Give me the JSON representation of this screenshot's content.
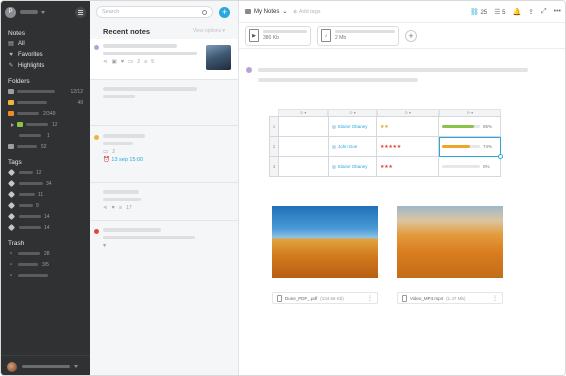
{
  "sidebar": {
    "avatar_letter": "P",
    "sections": {
      "notes": "Notes",
      "folders": "Folders",
      "tags": "Tags",
      "trash": "Trash"
    },
    "nav": [
      {
        "label": "All",
        "icon": "notes-icon"
      },
      {
        "label": "Favorites",
        "icon": "heart-icon"
      },
      {
        "label": "Highlights",
        "icon": "pen-icon"
      }
    ],
    "folders": [
      {
        "count": "12/12",
        "color": "#9b9ea1"
      },
      {
        "count": "49",
        "color": "#f0b437"
      },
      {
        "count": "2/349",
        "color": "#f08a24"
      },
      {
        "count": "12",
        "color": "#8bc34a"
      },
      {
        "count": "1",
        "color": "#9b9ea1"
      },
      {
        "count": "52",
        "color": "#9b9ea1"
      }
    ],
    "tags": [
      "12",
      "34",
      "11",
      "9",
      "14",
      "14"
    ],
    "trash": [
      "28",
      "3/5",
      ""
    ]
  },
  "notes_list": {
    "search_placeholder": "Search",
    "header": "Recent notes",
    "view_options": "View options",
    "notes": [
      {
        "dot": "#b9a3d6",
        "likes": "2",
        "comments": "5",
        "has_thumb": true
      },
      {
        "dot": "",
        "has_thumb": false
      },
      {
        "dot": "#f0b437",
        "comments": "2",
        "reminder": "13 sep 15:00"
      },
      {
        "dot": "",
        "comments": "17"
      },
      {
        "dot": "#e0473d"
      }
    ]
  },
  "editor": {
    "breadcrumb": "My Notes",
    "add_tag": "Add tags",
    "counters": {
      "links": "25",
      "checklist": "5"
    },
    "attachments": [
      {
        "size": "380 Kb",
        "type": "video"
      },
      {
        "size": "2 Mb",
        "type": "audio"
      }
    ],
    "table": {
      "rows": [
        {
          "n": "1",
          "person": "Elaine Obaney",
          "stars": "★★",
          "star_color": "gold",
          "progress": 0.85,
          "pct": "85%",
          "bar": "#8bc34a"
        },
        {
          "n": "2",
          "person": "John Doe",
          "stars": "★★★★★",
          "star_color": "red",
          "progress": 0.74,
          "pct": "74%",
          "bar": "#f0a524"
        },
        {
          "n": "3",
          "person": "Elaine Obaney",
          "stars": "★★★",
          "star_color": "red",
          "progress": 0.0,
          "pct": "0%",
          "bar": "#e6e7e9"
        }
      ]
    },
    "images": [
      {
        "name": "Dune_PDF_.pdf",
        "size": "(134.56 Kb)"
      },
      {
        "name": "Video_MP4.mp4",
        "size": "(1.47 Mb)"
      }
    ]
  }
}
